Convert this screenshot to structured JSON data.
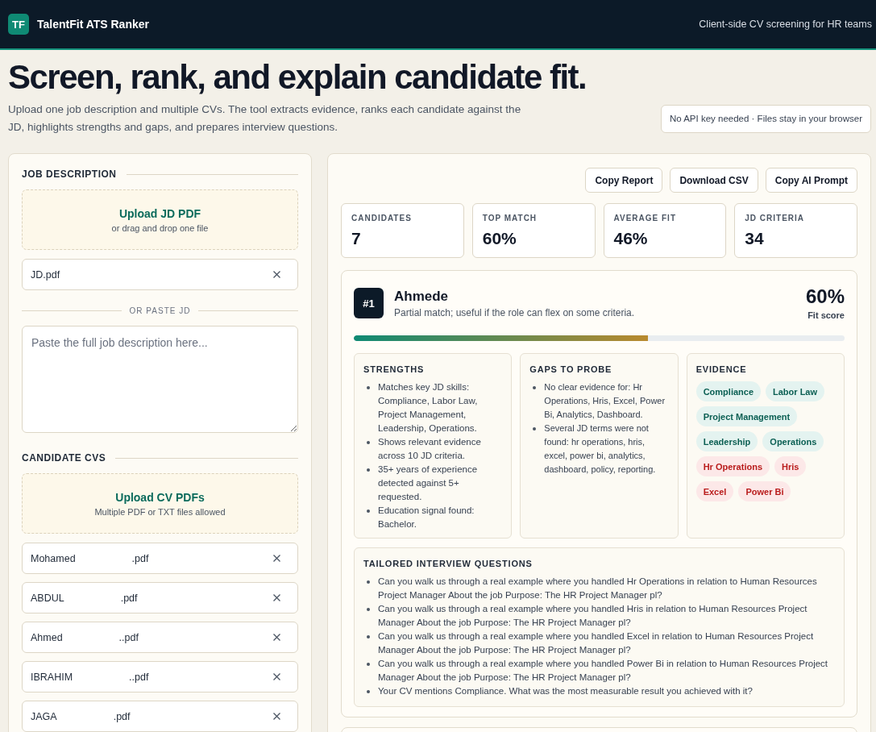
{
  "header": {
    "logo": "TF",
    "title": "TalentFit ATS Ranker",
    "tagline": "Client-side CV screening for HR teams"
  },
  "hero": {
    "title": "Screen, rank, and explain candidate fit.",
    "description": "Upload one job description and multiple CVs. The tool extracts evidence, ranks each candidate against the JD, highlights strengths and gaps, and prepares interview questions.",
    "privacy_note": "No API key needed · Files stay in your browser"
  },
  "job_description": {
    "heading": "JOB DESCRIPTION",
    "upload": {
      "title": "Upload JD PDF",
      "hint": "or drag and drop one file"
    },
    "files": [
      {
        "name": "JD.pdf"
      }
    ],
    "divider": "OR PASTE JD",
    "paste_field": {
      "placeholder": "Paste the full job description here..."
    }
  },
  "candidate_cvs": {
    "heading": "CANDIDATE CVS",
    "upload": {
      "title": "Upload CV PDFs",
      "hint": "Multiple PDF or TXT files allowed"
    },
    "files": [
      {
        "name": "Mohamed",
        "suffix": ".pdf"
      },
      {
        "name": "ABDUL",
        "suffix": ".pdf"
      },
      {
        "name": "Ahmed",
        "suffix": "..pdf"
      },
      {
        "name": "IBRAHIM",
        "suffix": "..pdf"
      },
      {
        "name": "JAGA",
        "suffix": ".pdf"
      }
    ]
  },
  "actions": [
    "Copy Report",
    "Download CSV",
    "Copy AI Prompt"
  ],
  "stats": [
    {
      "label": "CANDIDATES",
      "value": "7"
    },
    {
      "label": "TOP MATCH",
      "value": "60%"
    },
    {
      "label": "AVERAGE FIT",
      "value": "46%"
    },
    {
      "label": "JD CRITERIA",
      "value": "34"
    }
  ],
  "candidates": [
    {
      "rank": "#1",
      "name": "Ahmede",
      "summary": "Partial match; useful if the role can flex on some criteria.",
      "score": "60%",
      "score_label": "Fit score",
      "level": 0.6,
      "strengths": {
        "heading": "STRENGTHS",
        "items": [
          "Matches key JD skills: Compliance, Labor Law, Project Management, Leadership, Operations.",
          "Shows relevant evidence across 10 JD criteria.",
          "35+ years of experience detected against 5+ requested.",
          "Education signal found: Bachelor."
        ]
      },
      "gaps": {
        "heading": "GAPS TO PROBE",
        "items": [
          "No clear evidence for: Hr Operations, Hris, Excel, Power Bi, Analytics, Dashboard.",
          "Several JD terms were not found: hr operations, hris, excel, power bi, analytics, dashboard, policy, reporting."
        ]
      },
      "evidence": {
        "heading": "EVIDENCE",
        "tags": [
          {
            "label": "Compliance",
            "matched": true
          },
          {
            "label": "Labor Law",
            "matched": true
          },
          {
            "label": "Project Management",
            "matched": true
          },
          {
            "label": "Leadership",
            "matched": true
          },
          {
            "label": "Operations",
            "matched": true
          },
          {
            "label": "Hr Operations",
            "matched": false
          },
          {
            "label": "Hris",
            "matched": false
          },
          {
            "label": "Excel",
            "matched": false
          },
          {
            "label": "Power Bi",
            "matched": false
          }
        ]
      },
      "questions": {
        "heading": "TAILORED INTERVIEW QUESTIONS",
        "items": [
          "Can you walk us through a real example where you handled Hr Operations in relation to Human Resources Project Manager About the job Purpose: The HR Project Manager pl?",
          "Can you walk us through a real example where you handled Hris in relation to Human Resources Project Manager About the job Purpose: The HR Project Manager pl?",
          "Can you walk us through a real example where you handled Excel in relation to Human Resources Project Manager About the job Purpose: The HR Project Manager pl?",
          "Can you walk us through a real example where you handled Power Bi in relation to Human Resources Project Manager About the job Purpose: The HR Project Manager pl?",
          "Your CV mentions Compliance. What was the most measurable result you achieved with it?"
        ]
      }
    }
  ]
}
